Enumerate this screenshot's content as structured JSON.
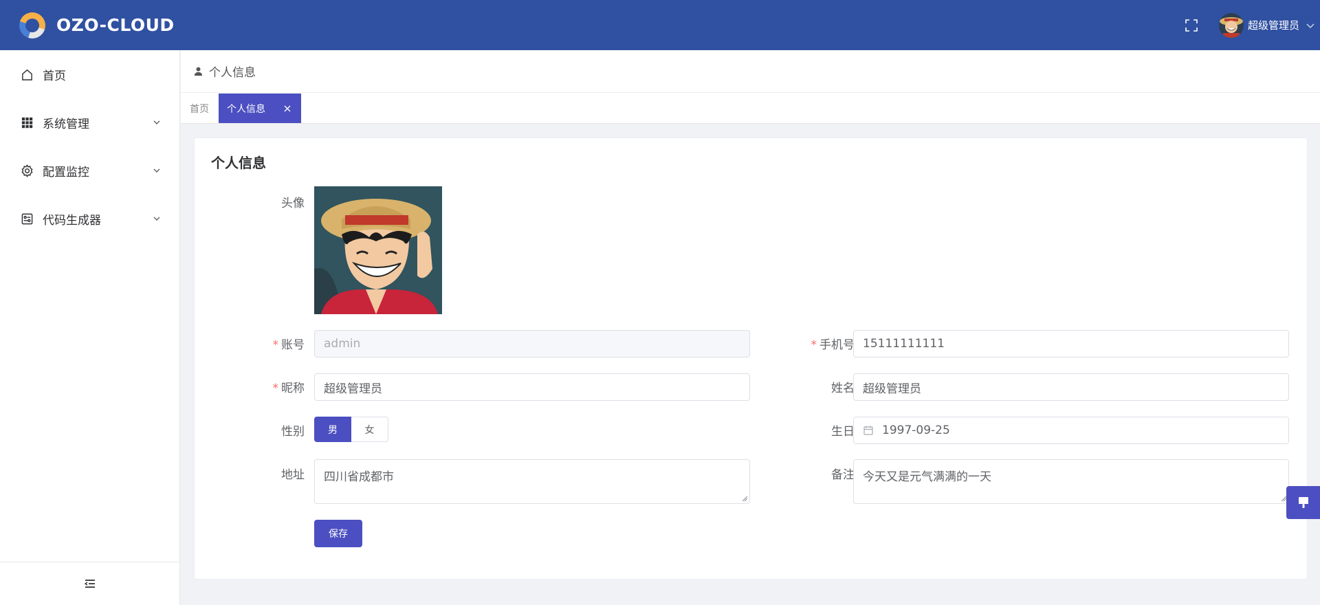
{
  "header": {
    "logo_text": "OZO-CLOUD",
    "user_name": "超级管理员",
    "bg_color": "#3051a1"
  },
  "sidebar": {
    "items": [
      {
        "label": "首页",
        "icon": "home-icon"
      },
      {
        "label": "系统管理",
        "icon": "grid-icon"
      },
      {
        "label": "配置监控",
        "icon": "gear-icon"
      },
      {
        "label": "代码生成器",
        "icon": "code-generator-icon"
      }
    ],
    "collapse_icon": "menu-collapse-icon"
  },
  "breadcrumb": {
    "icon": "user-icon",
    "text": "个人信息"
  },
  "tabs": {
    "home": "首页",
    "active": "个人信息"
  },
  "card": {
    "title": "个人信息",
    "labels": {
      "avatar": "头像",
      "account": "账号",
      "phone": "手机号",
      "nickname": "昵称",
      "name": "姓名",
      "gender": "性别",
      "birthday": "生日",
      "address": "地址",
      "remark": "备注"
    },
    "values": {
      "account": "admin",
      "phone": "15111111111",
      "nickname": "超级管理员",
      "name": "超级管理员",
      "birthday": "1997-09-25",
      "address": "四川省成都市",
      "remark": "今天又是元气满满的一天"
    },
    "gender_options": [
      "男",
      "女"
    ],
    "gender_selected": "男",
    "save_label": "保存"
  },
  "accent_color": "#4b4fc1"
}
